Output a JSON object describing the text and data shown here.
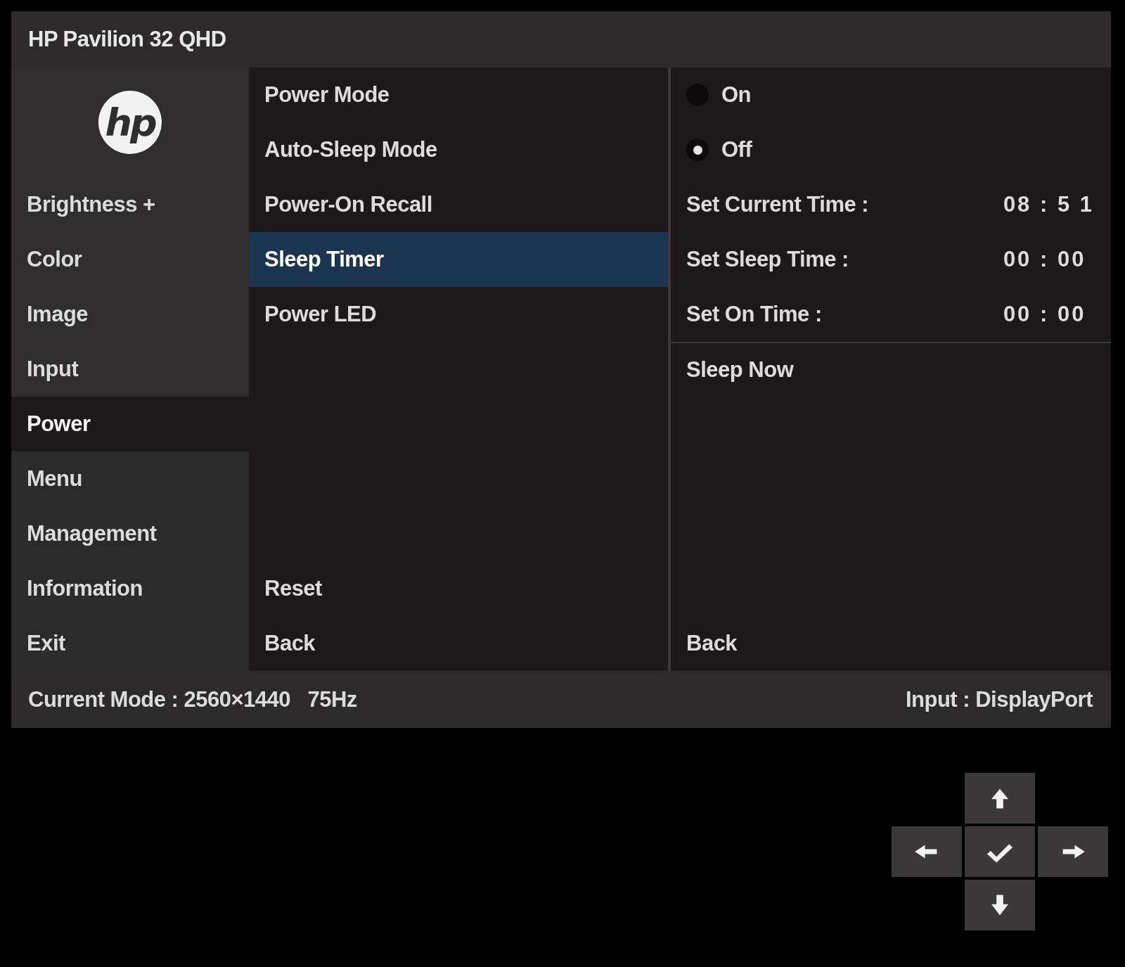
{
  "window": {
    "title": "HP Pavilion 32 QHD"
  },
  "logo": "hp",
  "main_menu": [
    {
      "label": "Brightness +",
      "selected": false
    },
    {
      "label": "Color",
      "selected": false
    },
    {
      "label": "Image",
      "selected": false
    },
    {
      "label": "Input",
      "selected": false
    },
    {
      "label": "Power",
      "selected": true
    },
    {
      "label": "Menu",
      "selected": false
    },
    {
      "label": "Management",
      "selected": false
    },
    {
      "label": "Information",
      "selected": false
    },
    {
      "label": "Exit",
      "selected": false
    }
  ],
  "submenu": {
    "items": [
      {
        "label": "Power Mode",
        "selected": false
      },
      {
        "label": "Auto-Sleep Mode",
        "selected": false
      },
      {
        "label": "Power-On Recall",
        "selected": false
      },
      {
        "label": "Sleep Timer",
        "selected": true
      },
      {
        "label": "Power LED",
        "selected": false
      }
    ],
    "footer": [
      "Reset",
      "Back"
    ]
  },
  "options": {
    "radios": [
      {
        "label": "On",
        "selected": false
      },
      {
        "label": "Off",
        "selected": true
      }
    ],
    "settings": [
      {
        "label": "Set Current Time :",
        "value": "08 : 5 1"
      },
      {
        "label": "Set Sleep Time :",
        "value": "00 : 00"
      },
      {
        "label": "Set On Time :",
        "value": "00 : 00"
      }
    ],
    "action": "Sleep Now",
    "back": "Back"
  },
  "status_bar": {
    "mode": "Current Mode : 2560×1440   75Hz",
    "input": "Input : DisplayPort"
  }
}
